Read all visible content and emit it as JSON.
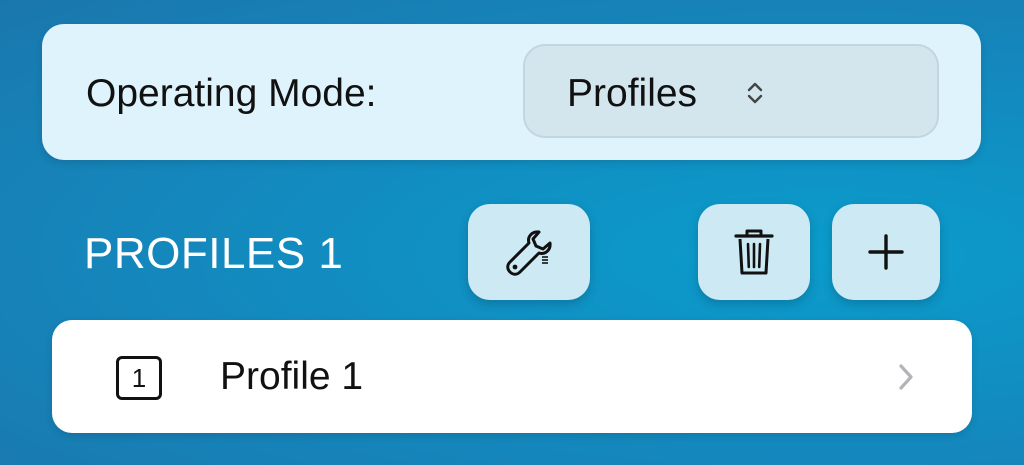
{
  "operating_mode": {
    "label": "Operating Mode:",
    "selected_value": "Profiles",
    "select_icon": "chevron-up-down-icon"
  },
  "profiles_section": {
    "title": "PROFILES 1",
    "buttons": {
      "settings_icon": "wrench-icon",
      "delete_icon": "trash-icon",
      "add_icon": "plus-icon"
    }
  },
  "profiles": [
    {
      "number": "1",
      "name": "Profile 1",
      "icon": "chevron-right-icon"
    }
  ],
  "colors": {
    "background": "#1488bd",
    "card": "#def3fb",
    "button": "#cdeaf4",
    "row": "#ffffff"
  }
}
